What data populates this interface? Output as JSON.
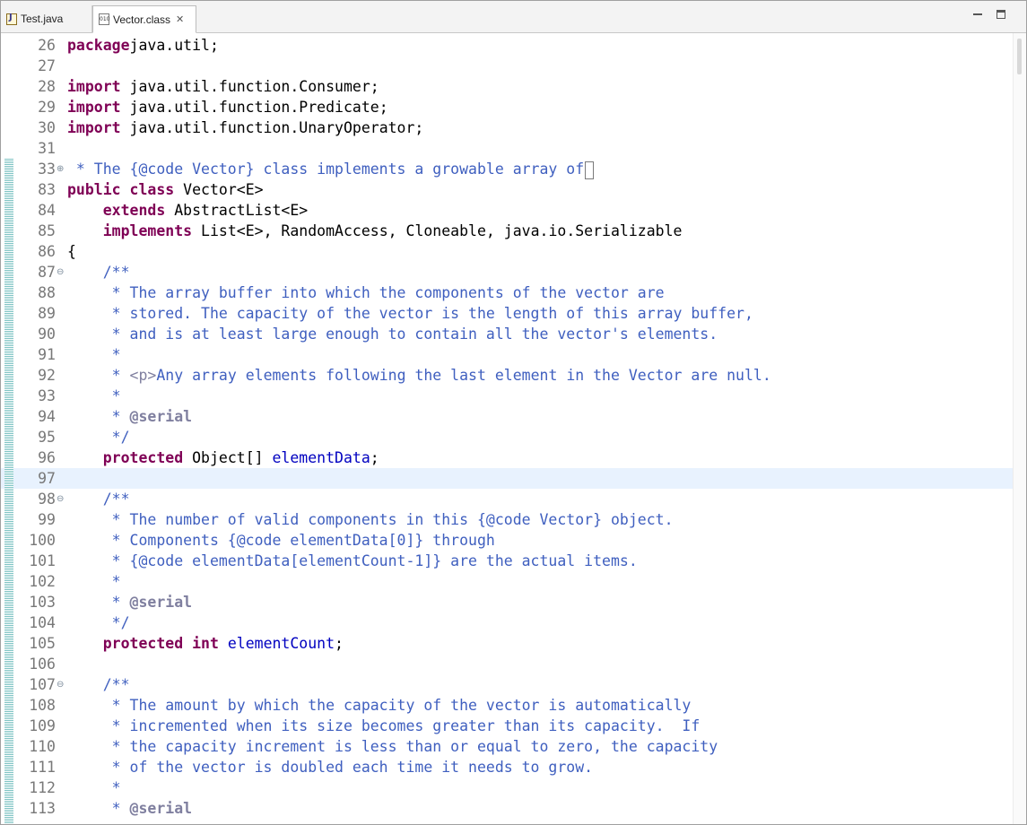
{
  "tabs": [
    {
      "label": "Test.java",
      "icon": "java-file-icon",
      "active": false
    },
    {
      "label": "Vector.class",
      "icon": "class-file-icon",
      "active": true,
      "close": "✕"
    }
  ],
  "colors": {
    "keyword": "#7f0055",
    "javadoc": "#3f5fbf",
    "javadoc_tag": "#7f7f9f",
    "field": "#0000c0",
    "current_line": "#e8f2fe",
    "line_number": "#787878"
  },
  "lines": [
    {
      "n": "26",
      "t": [
        [
          "kw",
          "package"
        ],
        [
          "",
          "java.util;"
        ]
      ]
    },
    {
      "n": "27",
      "t": []
    },
    {
      "n": "28",
      "t": [
        [
          "kw",
          "import"
        ],
        [
          "",
          " java.util.function.Consumer;"
        ]
      ]
    },
    {
      "n": "29",
      "t": [
        [
          "kw",
          "import"
        ],
        [
          "",
          " java.util.function.Predicate;"
        ]
      ]
    },
    {
      "n": "30",
      "t": [
        [
          "kw",
          "import"
        ],
        [
          "",
          " java.util.function.UnaryOperator;"
        ]
      ]
    },
    {
      "n": "31",
      "t": []
    },
    {
      "n": "33",
      "fold": "+",
      "cursor": true,
      "t": [
        [
          "cm",
          " * The {@code Vector} class implements a growable array of"
        ]
      ]
    },
    {
      "n": "83",
      "t": [
        [
          "kw",
          "public class"
        ],
        [
          "",
          " Vector<E>"
        ]
      ]
    },
    {
      "n": "84",
      "t": [
        [
          "",
          "    "
        ],
        [
          "kw",
          "extends"
        ],
        [
          "",
          " AbstractList<E>"
        ]
      ]
    },
    {
      "n": "85",
      "t": [
        [
          "",
          "    "
        ],
        [
          "kw",
          "implements"
        ],
        [
          "",
          " List<E>, RandomAccess, Cloneable, java.io.Serializable"
        ]
      ]
    },
    {
      "n": "86",
      "t": [
        [
          "",
          "{"
        ]
      ]
    },
    {
      "n": "87",
      "fold": "-",
      "t": [
        [
          "cm",
          "    /**"
        ]
      ]
    },
    {
      "n": "88",
      "t": [
        [
          "cm",
          "     * The array buffer into which the components of the vector are"
        ]
      ]
    },
    {
      "n": "89",
      "t": [
        [
          "cm",
          "     * stored. The capacity of the vector is the length of this array buffer,"
        ]
      ]
    },
    {
      "n": "90",
      "t": [
        [
          "cm",
          "     * and is at least large enough to contain all the vector's elements."
        ]
      ]
    },
    {
      "n": "91",
      "t": [
        [
          "cm",
          "     *"
        ]
      ]
    },
    {
      "n": "92",
      "t": [
        [
          "cm",
          "     * "
        ],
        [
          "ht",
          "<p>"
        ],
        [
          "cm",
          "Any array elements following the last element in the Vector are null."
        ]
      ]
    },
    {
      "n": "93",
      "t": [
        [
          "cm",
          "     *"
        ]
      ]
    },
    {
      "n": "94",
      "t": [
        [
          "cm",
          "     * "
        ],
        [
          "tg",
          "@serial"
        ]
      ]
    },
    {
      "n": "95",
      "t": [
        [
          "cm",
          "     */"
        ]
      ]
    },
    {
      "n": "96",
      "t": [
        [
          "",
          "    "
        ],
        [
          "kw",
          "protected"
        ],
        [
          "",
          " Object[] "
        ],
        [
          "fd",
          "elementData"
        ],
        [
          "",
          ";"
        ]
      ]
    },
    {
      "n": "97",
      "hl": true,
      "t": []
    },
    {
      "n": "98",
      "fold": "-",
      "t": [
        [
          "cm",
          "    /**"
        ]
      ]
    },
    {
      "n": "99",
      "t": [
        [
          "cm",
          "     * The number of valid components in this {@code Vector} object."
        ]
      ]
    },
    {
      "n": "100",
      "t": [
        [
          "cm",
          "     * Components {@code elementData[0]} through"
        ]
      ]
    },
    {
      "n": "101",
      "t": [
        [
          "cm",
          "     * {@code elementData[elementCount-1]} are the actual items."
        ]
      ]
    },
    {
      "n": "102",
      "t": [
        [
          "cm",
          "     *"
        ]
      ]
    },
    {
      "n": "103",
      "t": [
        [
          "cm",
          "     * "
        ],
        [
          "tg",
          "@serial"
        ]
      ]
    },
    {
      "n": "104",
      "t": [
        [
          "cm",
          "     */"
        ]
      ]
    },
    {
      "n": "105",
      "t": [
        [
          "",
          "    "
        ],
        [
          "kw",
          "protected int"
        ],
        [
          "",
          " "
        ],
        [
          "fd",
          "elementCount"
        ],
        [
          "",
          ";"
        ]
      ]
    },
    {
      "n": "106",
      "t": []
    },
    {
      "n": "107",
      "fold": "-",
      "t": [
        [
          "cm",
          "    /**"
        ]
      ]
    },
    {
      "n": "108",
      "t": [
        [
          "cm",
          "     * The amount by which the capacity of the vector is automatically"
        ]
      ]
    },
    {
      "n": "109",
      "t": [
        [
          "cm",
          "     * incremented when its size becomes greater than its capacity.  If"
        ]
      ]
    },
    {
      "n": "110",
      "t": [
        [
          "cm",
          "     * the capacity increment is less than or equal to zero, the capacity"
        ]
      ]
    },
    {
      "n": "111",
      "t": [
        [
          "cm",
          "     * of the vector is doubled each time it needs to grow."
        ]
      ]
    },
    {
      "n": "112",
      "t": [
        [
          "cm",
          "     *"
        ]
      ]
    },
    {
      "n": "113",
      "t": [
        [
          "cm",
          "     * "
        ],
        [
          "tg",
          "@serial"
        ]
      ]
    }
  ]
}
